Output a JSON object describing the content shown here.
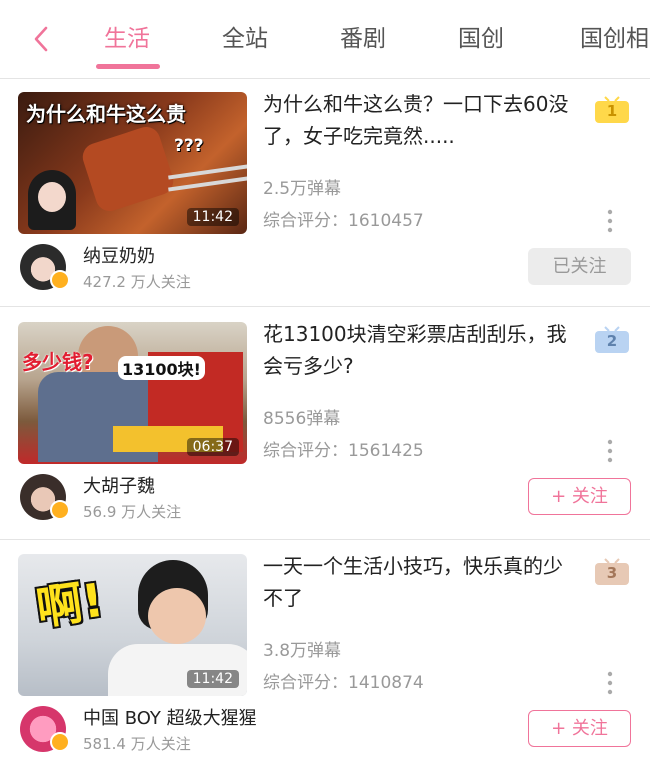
{
  "tabs": [
    {
      "label": "生活",
      "active": true
    },
    {
      "label": "全站",
      "active": false
    },
    {
      "label": "番剧",
      "active": false
    },
    {
      "label": "国创",
      "active": false
    },
    {
      "label": "国创相",
      "active": false
    }
  ],
  "colors": {
    "accent": "#f0749a",
    "rank1": "#ffd84a",
    "rank2": "#b9d3f2",
    "rank3": "#e7c9b5"
  },
  "cards": [
    {
      "rank": "1",
      "title": "为什么和牛这么贵？一口下去60没了，女子吃完竟然.....",
      "thumb_text": "为什么和牛这么贵",
      "thumb_text2": "???",
      "duration": "11:42",
      "danmu": "2.5万弹幕",
      "score": "综合评分：1610457",
      "uploader": "纳豆奶奶",
      "followers": "427.2 万人关注",
      "follow_label": "已关注",
      "followed": true
    },
    {
      "rank": "2",
      "title": "花13100块清空彩票店刮刮乐，我会亏多少?",
      "thumb_text": "多少钱?",
      "thumb_text2": "13100块!",
      "duration": "06:37",
      "danmu": "8556弹幕",
      "score": "综合评分：1561425",
      "uploader": "大胡子魏",
      "followers": "56.9 万人关注",
      "follow_label": "+ 关注",
      "followed": false
    },
    {
      "rank": "3",
      "title": "一天一个生活小技巧，快乐真的少不了",
      "thumb_text": "啊!",
      "thumb_text2": "",
      "duration": "11:42",
      "danmu": "3.8万弹幕",
      "score": "综合评分：1410874",
      "uploader": "中国 BOY 超级大猩猩",
      "followers": "581.4 万人关注",
      "follow_label": "+ 关注",
      "followed": false
    }
  ]
}
